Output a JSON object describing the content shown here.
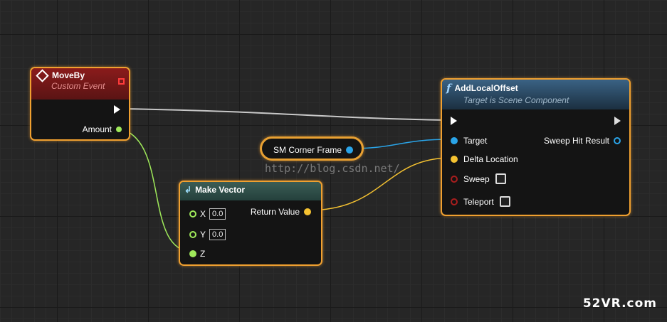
{
  "nodes": {
    "moveby": {
      "title": "MoveBy",
      "subtitle": "Custom Event",
      "amount_label": "Amount"
    },
    "sm_corner": {
      "label": "SM Corner Frame"
    },
    "make_vector": {
      "title": "Make Vector",
      "x_label": "X",
      "x_value": "0.0",
      "y_label": "Y",
      "y_value": "0.0",
      "z_label": "Z",
      "return_label": "Return Value"
    },
    "add_local_offset": {
      "title": "AddLocalOffset",
      "subtitle": "Target is Scene Component",
      "target_label": "Target",
      "sweep_hit_label": "Sweep Hit Result",
      "delta_label": "Delta Location",
      "sweep_label": "Sweep",
      "teleport_label": "Teleport"
    }
  },
  "watermark": "http://blog.csdn.net/",
  "brand": "52VR.com",
  "colors": {
    "node_border": "#f0a030",
    "event_header": "#8a1b1b",
    "function_header": "#2e4c66",
    "float_pin": "#9fe95a",
    "object_pin": "#2aa4e8",
    "vector_pin": "#f5c231",
    "bool_pin": "#a81e1e",
    "exec_wire": "#c8c8c8"
  }
}
